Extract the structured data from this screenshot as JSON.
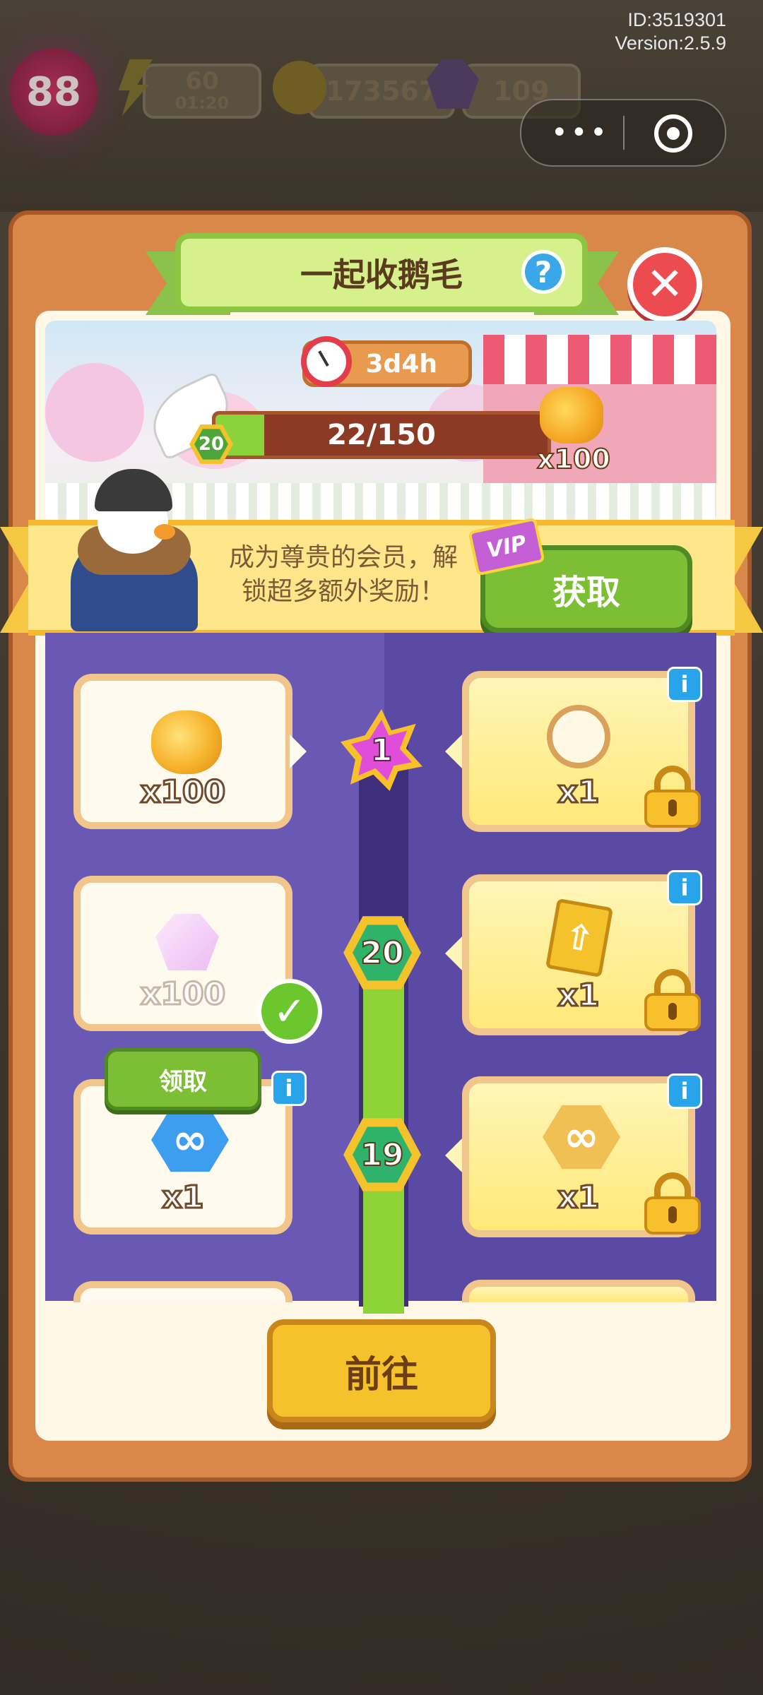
{
  "meta": {
    "id": "ID:3519301",
    "version": "Version:2.5.9"
  },
  "hud": {
    "level": "88",
    "energy": "60",
    "energy_timer": "01:20",
    "coins": "173567",
    "gems": "109"
  },
  "dialog": {
    "title": "一起收鹅毛",
    "help_label": "?",
    "close_label": "✕",
    "timer": "3d4h",
    "progress_text": "22/150",
    "progress_value": 22,
    "progress_max": 150,
    "current_level": "20",
    "milestone_reward": "x100"
  },
  "vip": {
    "line1": "成为尊贵的会员，解",
    "line2": "锁超多额外奖励！",
    "tag": "VIP",
    "get_label": "获取"
  },
  "rewards": [
    {
      "level": "1",
      "free": "x100",
      "free_icon": "coins-icon",
      "premium": "x1",
      "premium_icon": "stopwatch-icon",
      "claimed": false
    },
    {
      "level": "20",
      "free": "x100",
      "free_icon": "gems-icon",
      "premium": "x1",
      "premium_icon": "arrow-card-icon",
      "claimed": true
    },
    {
      "level": "19",
      "free": "x1",
      "free_icon": "infinity-blue-icon",
      "premium": "x1",
      "premium_icon": "infinity-gold-icon",
      "claimed": false
    }
  ],
  "claim_label": "领取",
  "goto_label": "前往",
  "colors": {
    "primary_green": "#7cbf34",
    "accent_yellow": "#f6c22b",
    "panel_orange": "#d9884a",
    "track_purple": "#6a59b4"
  }
}
